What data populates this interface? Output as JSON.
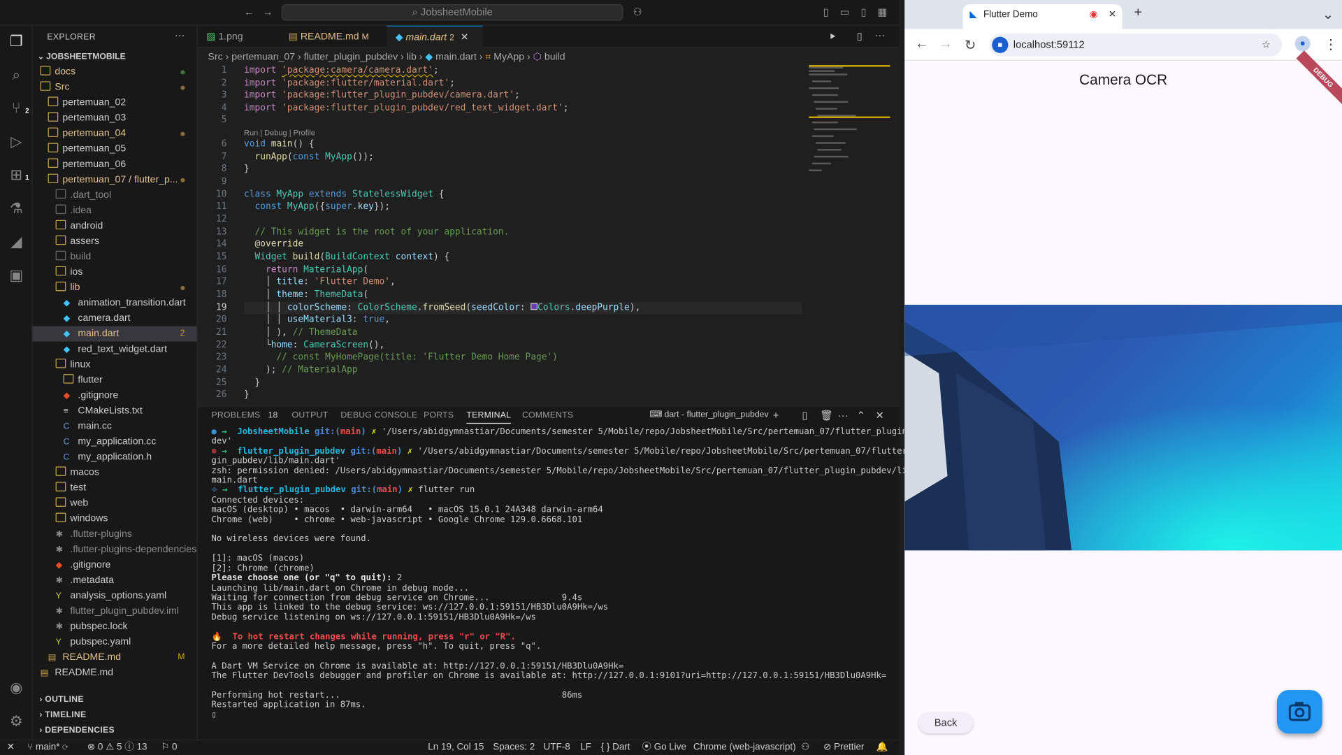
{
  "titlebar": {
    "search_text": "JobsheetMobile"
  },
  "activity_badges": {
    "source_control": "2",
    "extensions": "1"
  },
  "explorer": {
    "title": "EXPLORER",
    "root": "JOBSHEETMOBILE",
    "items": [
      {
        "label": "docs",
        "indent": 1,
        "type": "folder",
        "color": "#c9a550",
        "status": "dot-green"
      },
      {
        "label": "Src",
        "indent": 1,
        "type": "folder",
        "color": "#c9a550",
        "status": "dot"
      },
      {
        "label": "pertemuan_02",
        "indent": 2,
        "type": "folder"
      },
      {
        "label": "pertemuan_03",
        "indent": 2,
        "type": "folder"
      },
      {
        "label": "pertemuan_04",
        "indent": 2,
        "type": "folder",
        "color": "#c9a550",
        "status": "dot"
      },
      {
        "label": "pertemuan_05",
        "indent": 2,
        "type": "folder"
      },
      {
        "label": "pertemuan_06",
        "indent": 2,
        "type": "folder"
      },
      {
        "label": "pertemuan_07 / flutter_p...",
        "indent": 2,
        "type": "folder",
        "color": "#c9a550",
        "status": "dot"
      },
      {
        "label": ".dart_tool",
        "indent": 3,
        "type": "folder",
        "dim": true
      },
      {
        "label": ".idea",
        "indent": 3,
        "type": "folder",
        "dim": true
      },
      {
        "label": "android",
        "indent": 3,
        "type": "folder"
      },
      {
        "label": "assers",
        "indent": 3,
        "type": "folder"
      },
      {
        "label": "build",
        "indent": 3,
        "type": "folder",
        "dim": true
      },
      {
        "label": "ios",
        "indent": 3,
        "type": "folder"
      },
      {
        "label": "lib",
        "indent": 3,
        "type": "folder",
        "color": "#c9a550",
        "status": "dot"
      },
      {
        "label": "animation_transition.dart",
        "indent": 4,
        "type": "dart"
      },
      {
        "label": "camera.dart",
        "indent": 4,
        "type": "dart"
      },
      {
        "label": "main.dart",
        "indent": 4,
        "type": "dart",
        "color": "#c9a550",
        "status": "2",
        "selected": true
      },
      {
        "label": "red_text_widget.dart",
        "indent": 4,
        "type": "dart"
      },
      {
        "label": "linux",
        "indent": 3,
        "type": "folder"
      },
      {
        "label": "flutter",
        "indent": 4,
        "type": "folder"
      },
      {
        "label": ".gitignore",
        "indent": 4,
        "type": "git"
      },
      {
        "label": "CMakeLists.txt",
        "indent": 4,
        "type": "txt"
      },
      {
        "label": "main.cc",
        "indent": 4,
        "type": "c"
      },
      {
        "label": "my_application.cc",
        "indent": 4,
        "type": "c"
      },
      {
        "label": "my_application.h",
        "indent": 4,
        "type": "c"
      },
      {
        "label": "macos",
        "indent": 3,
        "type": "folder"
      },
      {
        "label": "test",
        "indent": 3,
        "type": "folder"
      },
      {
        "label": "web",
        "indent": 3,
        "type": "folder"
      },
      {
        "label": "windows",
        "indent": 3,
        "type": "folder"
      },
      {
        "label": ".flutter-plugins",
        "indent": 3,
        "type": "star",
        "dim": true
      },
      {
        "label": ".flutter-plugins-dependencies",
        "indent": 3,
        "type": "star",
        "dim": true
      },
      {
        "label": ".gitignore",
        "indent": 3,
        "type": "git"
      },
      {
        "label": ".metadata",
        "indent": 3,
        "type": "star"
      },
      {
        "label": "analysis_options.yaml",
        "indent": 3,
        "type": "yaml"
      },
      {
        "label": "flutter_plugin_pubdev.iml",
        "indent": 3,
        "type": "star",
        "dim": true
      },
      {
        "label": "pubspec.lock",
        "indent": 3,
        "type": "star"
      },
      {
        "label": "pubspec.yaml",
        "indent": 3,
        "type": "yaml"
      },
      {
        "label": "README.md",
        "indent": 2,
        "type": "md",
        "color": "#c9a550",
        "status": "M"
      },
      {
        "label": "README.md",
        "indent": 1,
        "type": "md"
      }
    ],
    "sections": [
      "OUTLINE",
      "TIMELINE",
      "DEPENDENCIES"
    ]
  },
  "tabs": [
    {
      "label": "1.png",
      "icon": "image"
    },
    {
      "label": "README.md",
      "suffix": "M",
      "icon": "md"
    },
    {
      "label": "main.dart",
      "suffix": "2",
      "icon": "dart",
      "active": true
    }
  ],
  "breadcrumb": [
    "Src",
    "pertemuan_07",
    "flutter_plugin_pubdev",
    "lib",
    "main.dart",
    "MyApp",
    "build"
  ],
  "editor": {
    "codelens": "Run | Debug | Profile",
    "lines": [
      "1",
      "2",
      "3",
      "4",
      "5",
      "6",
      "7",
      "8",
      "9",
      "10",
      "11",
      "12",
      "13",
      "14",
      "15",
      "16",
      "17",
      "18",
      "19",
      "20",
      "21",
      "22",
      "23",
      "24",
      "25",
      "26"
    ],
    "current_line": "19"
  },
  "panel": {
    "tabs": [
      "PROBLEMS",
      "OUTPUT",
      "DEBUG CONSOLE",
      "PORTS",
      "TERMINAL",
      "COMMENTS"
    ],
    "problems_count": "18",
    "terminal_name": "dart - flutter_plugin_pubdev"
  },
  "status": {
    "branch": "main*",
    "problems": "0",
    "warnings": "5",
    "info": "13",
    "ports": "0",
    "position": "Ln 19, Col 15",
    "spaces": "Spaces: 2",
    "encoding": "UTF-8",
    "eol": "LF",
    "language": "Dart",
    "golive": "Go Live",
    "device": "Chrome (web-javascript)",
    "prettier": "Prettier"
  },
  "browser": {
    "tab_title": "Flutter Demo",
    "url": "localhost:59112",
    "app_title": "Camera OCR",
    "back_label": "Back",
    "debug_label": "DEBUG"
  }
}
